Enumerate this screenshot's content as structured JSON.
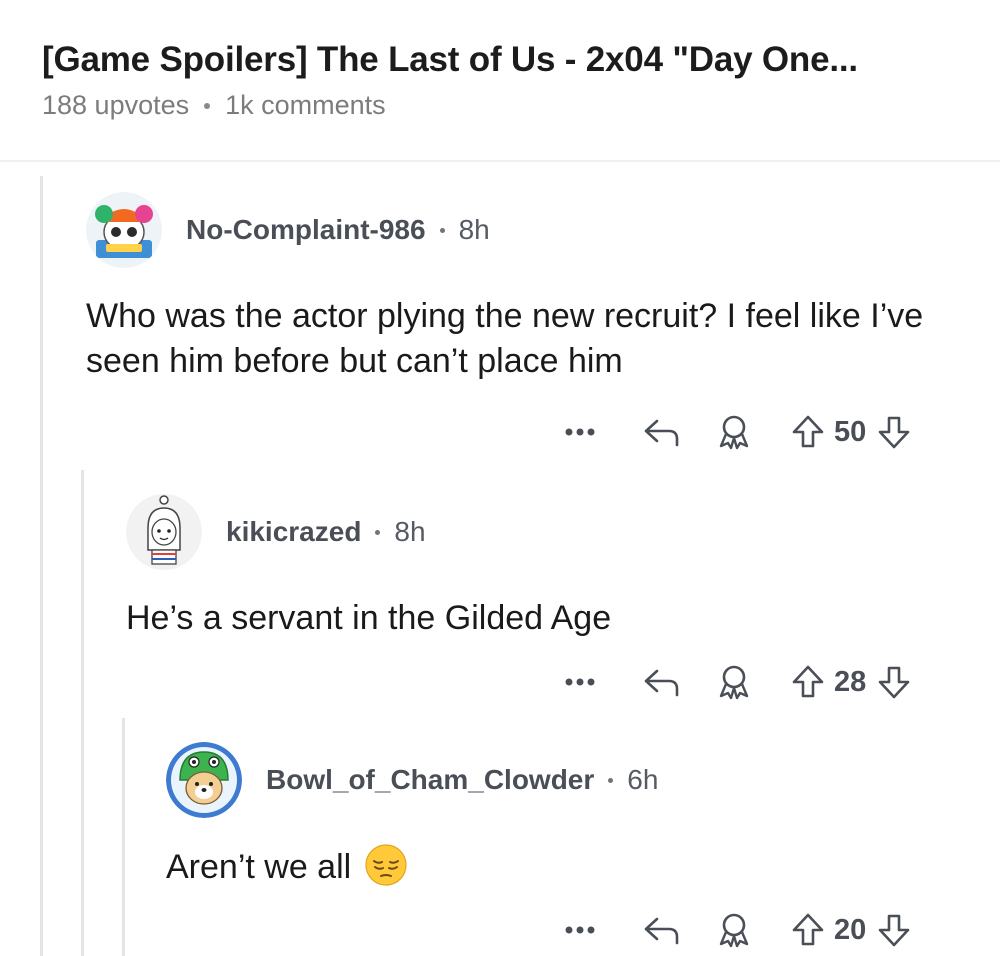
{
  "post": {
    "title": "[Game Spoilers] The Last of Us - 2x04 \"Day One...",
    "upvotes": "188 upvotes",
    "comments": "1k comments"
  },
  "comments": [
    {
      "username": "No-Complaint-986",
      "time": "8h",
      "body": "Who was the actor plying the new recruit? I feel like I’ve seen him before but can’t place him",
      "score": "50"
    },
    {
      "username": "kikicrazed",
      "time": "8h",
      "body": "He’s a servant in the Gilded Age",
      "score": "28"
    },
    {
      "username": "Bowl_of_Cham_Clowder",
      "time": "6h",
      "body": "Aren’t we all",
      "emoji": "pensive-face-emoji",
      "score": "20"
    }
  ],
  "icons": {
    "more": "more-options-icon",
    "reply": "reply-icon",
    "award": "award-icon",
    "upvote": "upvote-icon",
    "downvote": "downvote-icon"
  },
  "colors": {
    "icon": "#4a4f57",
    "thread_line": "#e4e4e4",
    "meta": "#7c7c7c"
  }
}
